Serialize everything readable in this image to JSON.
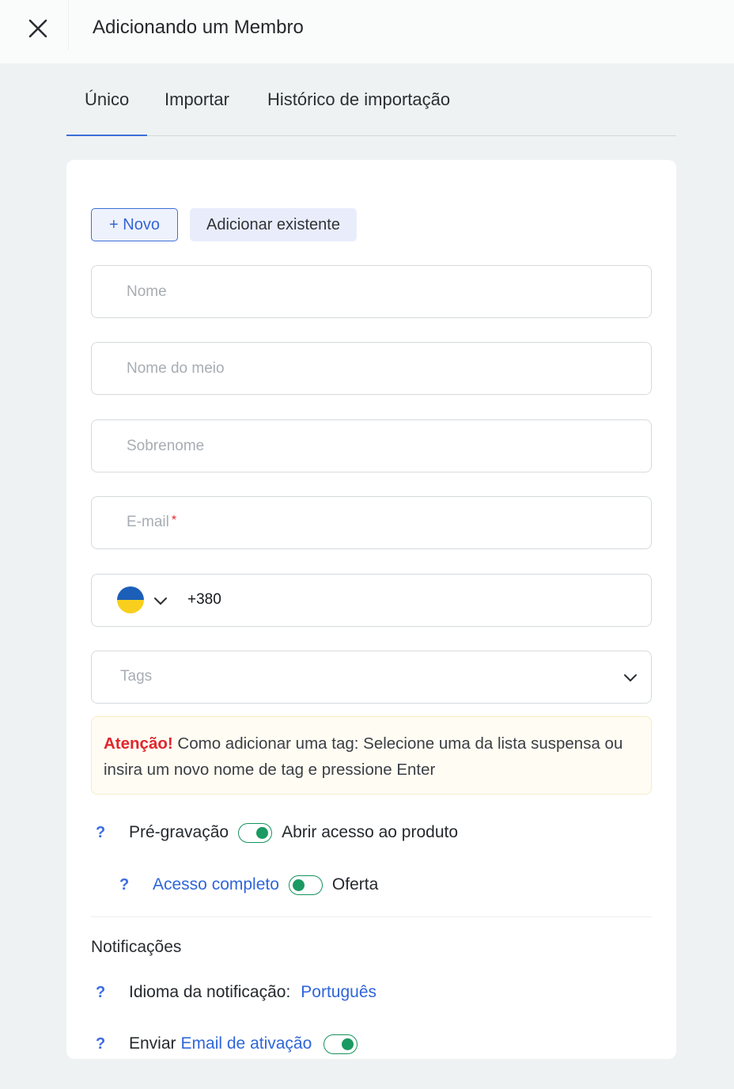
{
  "header": {
    "title": "Adicionando um Membro",
    "close_icon": "close-icon"
  },
  "tabs": [
    {
      "label": "Único",
      "active": true
    },
    {
      "label": "Importar",
      "active": false
    },
    {
      "label": "Histórico de importação",
      "active": false
    }
  ],
  "mode_buttons": {
    "new_label": "+ Novo",
    "existing_label": "Adicionar existente"
  },
  "form": {
    "first_name": {
      "placeholder": "Nome",
      "value": ""
    },
    "middle_name": {
      "placeholder": "Nome do meio",
      "value": ""
    },
    "last_name": {
      "placeholder": "Sobrenome",
      "value": ""
    },
    "email": {
      "placeholder": "E-mail",
      "required_mark": "*",
      "value": ""
    },
    "phone": {
      "country": "Ukraine",
      "flag_colors": [
        "#1c5fb8",
        "#f8cf1d"
      ],
      "code": "+380"
    },
    "tags": {
      "placeholder": "Tags"
    }
  },
  "alert": {
    "strong": "Atenção!",
    "text": " Como adicionar uma tag: Selecione uma da lista suspensa ou insira um novo nome de tag e pressione Enter"
  },
  "access": {
    "help_mark": "?",
    "pre_recording_label": "Pré-gravação",
    "pre_recording_toggle_on": true,
    "open_access_label": "Abrir acesso ao produto",
    "full_access_label": "Acesso completo",
    "full_access_toggle_on": false,
    "offer_label": "Oferta"
  },
  "notifications": {
    "title": "Notificações",
    "language_label": "Idioma da notificação:",
    "language_value": "Português",
    "send_label": "Enviar",
    "activation_email_label": "Email de ativação",
    "activation_toggle_on": true
  },
  "colors": {
    "accent": "#3b6fd9",
    "toggle_green": "#1a9a62",
    "warning_red": "#e0262d"
  }
}
